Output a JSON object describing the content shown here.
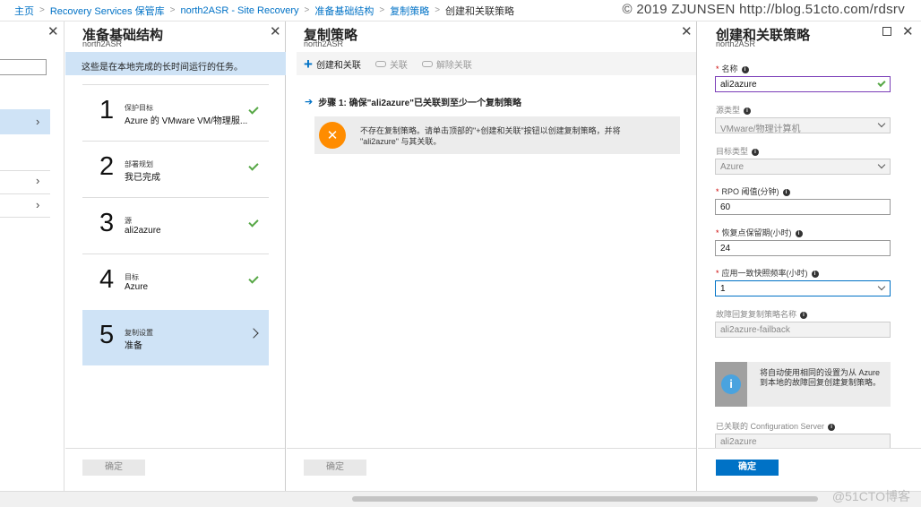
{
  "breadcrumb": [
    "主页",
    "Recovery Services 保管库",
    "north2ASR - Site Recovery",
    "准备基础结构",
    "复制策略",
    "创建和关联策略"
  ],
  "watermark": "© 2019 ZJUNSEN http://blog.51cto.com/rdsrv",
  "watermark2": "@51CTO博客",
  "blade1": {
    "title": "准备基础结构",
    "subtitle": "north2ASR",
    "banner": "这些是在本地完成的长时间运行的任务。",
    "steps": [
      {
        "num": "1",
        "label": "保护目标",
        "value": "Azure 的 VMware VM/物理服...",
        "state": "done"
      },
      {
        "num": "2",
        "label": "部署规划",
        "value": "我已完成",
        "state": "done"
      },
      {
        "num": "3",
        "label": "源",
        "value": "ali2azure",
        "state": "done"
      },
      {
        "num": "4",
        "label": "目标",
        "value": "Azure",
        "state": "done"
      },
      {
        "num": "5",
        "label": "复制设置",
        "value": "准备",
        "state": "current"
      }
    ],
    "ok_label": "确定"
  },
  "blade2": {
    "title": "复制策略",
    "subtitle": "north2ASR",
    "toolbar": {
      "create": "创建和关联",
      "associate": "关联",
      "dissociate": "解除关联"
    },
    "step_heading": "步骤 1: 确保\"ali2azure\"已关联到至少一个复制策略",
    "notice": "不存在复制策略。请单击顶部的\"+创建和关联\"按钮以创建复制策略，并将 \"ali2azure\" 与其关联。",
    "ok_label": "确定"
  },
  "blade3": {
    "title": "创建和关联策略",
    "subtitle": "north2ASR",
    "fields": {
      "name_label": "名称",
      "name_value": "ali2azure",
      "source_type_label": "源类型",
      "source_type_value": "VMware/物理计算机",
      "target_type_label": "目标类型",
      "target_type_value": "Azure",
      "rpo_label": "RPO 阈值(分钟)",
      "rpo_value": "60",
      "retention_label": "恢复点保留期(小时)",
      "retention_value": "24",
      "snapshot_label": "应用一致快照频率(小时)",
      "snapshot_value": "1",
      "failback_label": "故障回复复制策略名称",
      "failback_value": "ali2azure-failback",
      "config_server_label": "已关联的 Configuration Server",
      "config_server_value": "ali2azure"
    },
    "info_text": "将自动使用相同的设置为从 Azure 到本地的故障回复创建复制策略。",
    "ok_label": "确定"
  },
  "colors": {
    "accent": "#0072c6",
    "selected": "#cfe3f6",
    "check": "#56a745",
    "required": "#cc0000"
  }
}
